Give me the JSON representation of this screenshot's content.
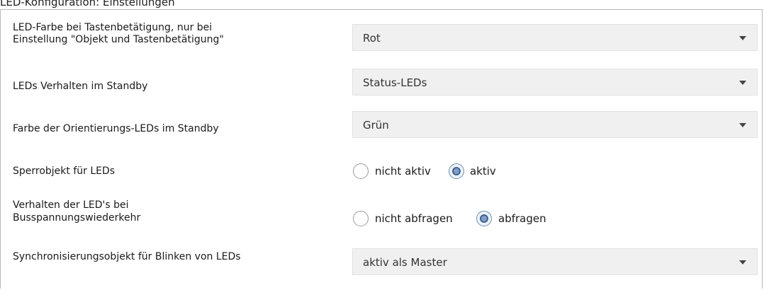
{
  "heading": "LED-Konfiguration: Einstellungen",
  "rows": [
    {
      "label_line1": "LED-Farbe bei Tastenbetätigung, nur bei",
      "label_line2": "Einstellung \"Objekt und Tastenbetätigung\"",
      "value": "Rot"
    },
    {
      "label": "LEDs Verhalten im Standby",
      "value": "Status-LEDs"
    },
    {
      "label": "Farbe der Orientierungs-LEDs im Standby",
      "value": "Grün"
    },
    {
      "label": "Sperrobjekt für LEDs",
      "options": [
        "nicht aktiv",
        "aktiv"
      ],
      "selected": "aktiv"
    },
    {
      "label_line1": "Verhalten der LED's  bei",
      "label_line2": "Busspannungswiederkehr",
      "options": [
        "nicht abfragen",
        "abfragen"
      ],
      "selected": "abfragen"
    },
    {
      "label": "Synchronisierungsobjekt für Blinken von LEDs",
      "value": "aktiv als Master"
    }
  ]
}
